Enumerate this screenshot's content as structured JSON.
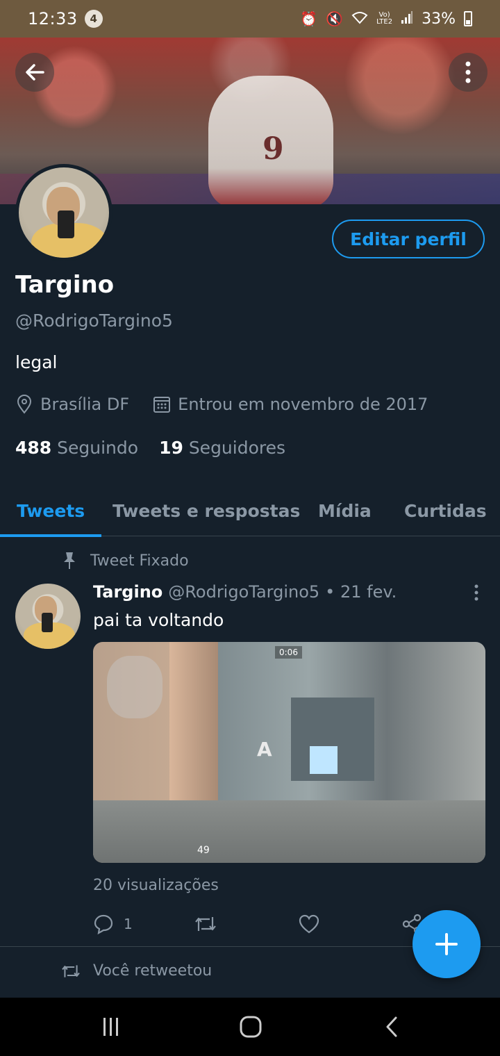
{
  "status_bar": {
    "time": "12:33",
    "notification_count": "4",
    "network_label_top": "Vo)",
    "network_label_bottom": "LTE2",
    "battery": "33%"
  },
  "profile": {
    "name": "Targino",
    "handle": "@RodrigoTargino5",
    "bio": "legal",
    "location": "Brasília DF",
    "joined": "Entrou em novembro de 2017",
    "following_count": "488",
    "following_label": "Seguindo",
    "followers_count": "19",
    "followers_label": "Seguidores",
    "edit_label": "Editar perfil"
  },
  "tabs": [
    {
      "label": "Tweets",
      "active": true
    },
    {
      "label": "Tweets e respostas",
      "active": false
    },
    {
      "label": "Mídia",
      "active": false
    },
    {
      "label": "Curtidas",
      "active": false
    }
  ],
  "pinned_tweet": {
    "pinned_label": "Tweet Fixado",
    "author_name": "Targino",
    "author_handle": "@RodrigoTargino5",
    "date": "• 21 fev.",
    "text": "pai ta voltando",
    "media_timer": "0:06",
    "media_hud": "49",
    "views": "20 visualizações",
    "reply_count": "1",
    "retweet_count": "",
    "like_count": ""
  },
  "next_tweet": {
    "retweeted_label": "Você retweetou"
  },
  "colors": {
    "background": "#15202b",
    "accent": "#1d9bf0",
    "secondary_text": "#8b98a5",
    "divider": "#38444d"
  }
}
